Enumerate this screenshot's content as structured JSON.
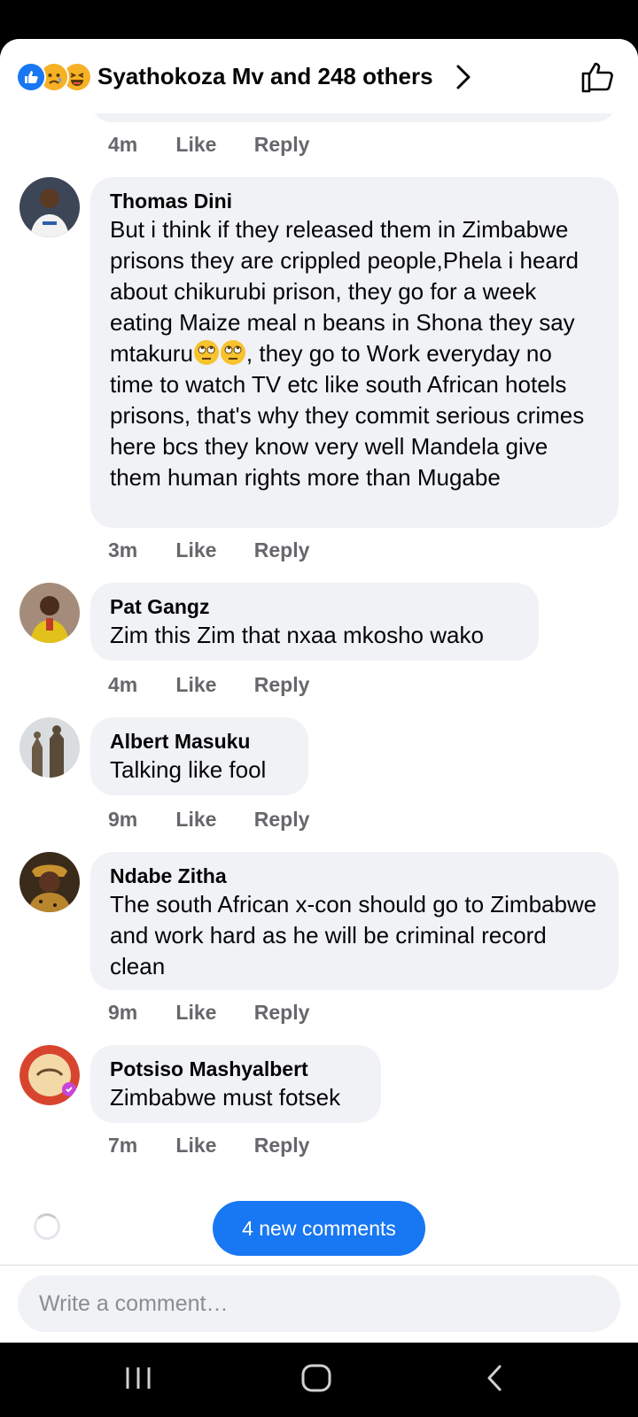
{
  "header": {
    "reactors_text": "Syathokoza Mv and 248 others",
    "reactions": [
      "like-reaction-icon",
      "sad-reaction-icon",
      "haha-reaction-icon"
    ]
  },
  "top_partial": {
    "time": "4m",
    "like": "Like",
    "reply": "Reply"
  },
  "comments": [
    {
      "author": "Thomas Dini",
      "text_part1": "But i think if they released them in Zimbabwe prisons they are crippled people,Phela i heard about chikurubi prison, they go for a week eating Maize meal n beans in Shona they say mtakuru",
      "text_part2": ", they go to Work everyday no time to watch TV etc like south African hotels prisons, that's why they commit serious crimes here bcs they know very well Mandela give them human rights more than Mugabe",
      "time": "3m",
      "like": "Like",
      "reply": "Reply"
    },
    {
      "author": "Pat Gangz",
      "text": "Zim this Zim that nxaa mkosho wako",
      "time": "4m",
      "like": "Like",
      "reply": "Reply"
    },
    {
      "author": "Albert Masuku",
      "text": "Talking like fool",
      "time": "9m",
      "like": "Like",
      "reply": "Reply"
    },
    {
      "author": "Ndabe Zitha",
      "text": "The south African x-con should go to Zimbabwe and work hard as he will be criminal record clean",
      "time": "9m",
      "like": "Like",
      "reply": "Reply"
    },
    {
      "author": "Potsiso Mashyalbert",
      "text": "Zimbabwe must fotsek",
      "time": "7m",
      "like": "Like",
      "reply": "Reply"
    }
  ],
  "new_comments_label": "4 new comments",
  "composer": {
    "placeholder": "Write a comment…"
  },
  "colors": {
    "accent": "#1877f2",
    "bubble": "#f0f2f5",
    "meta": "#65676b"
  }
}
